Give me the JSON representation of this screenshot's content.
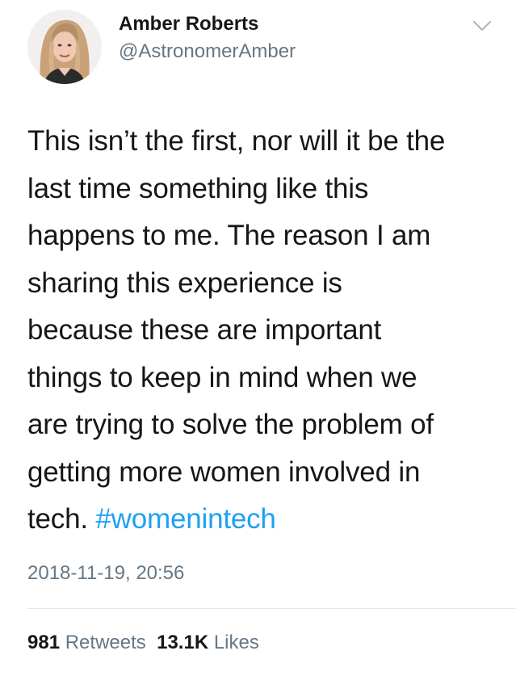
{
  "author": {
    "name": "Amber Roberts",
    "handle": "@AstronomerAmber",
    "avatar_icon": "profile-photo"
  },
  "menu_icon": "chevron-down-icon",
  "tweet": {
    "lines": [
      "This isn’t the first, nor will it be the",
      "last time something like this",
      "happens to me. The reason I am",
      "sharing this experience is",
      "because these are important",
      "things to keep in mind when we",
      "are trying to solve the problem of",
      "getting more women involved in"
    ],
    "last_line_text": "tech. ",
    "hashtag": "#womenintech",
    "hashtag_color": "#1da1f2"
  },
  "timestamp": "2018-11-19, 20:56",
  "stats": {
    "retweets_count": "981",
    "retweets_label": "Retweets",
    "likes_count": "13.1K",
    "likes_label": "Likes"
  }
}
